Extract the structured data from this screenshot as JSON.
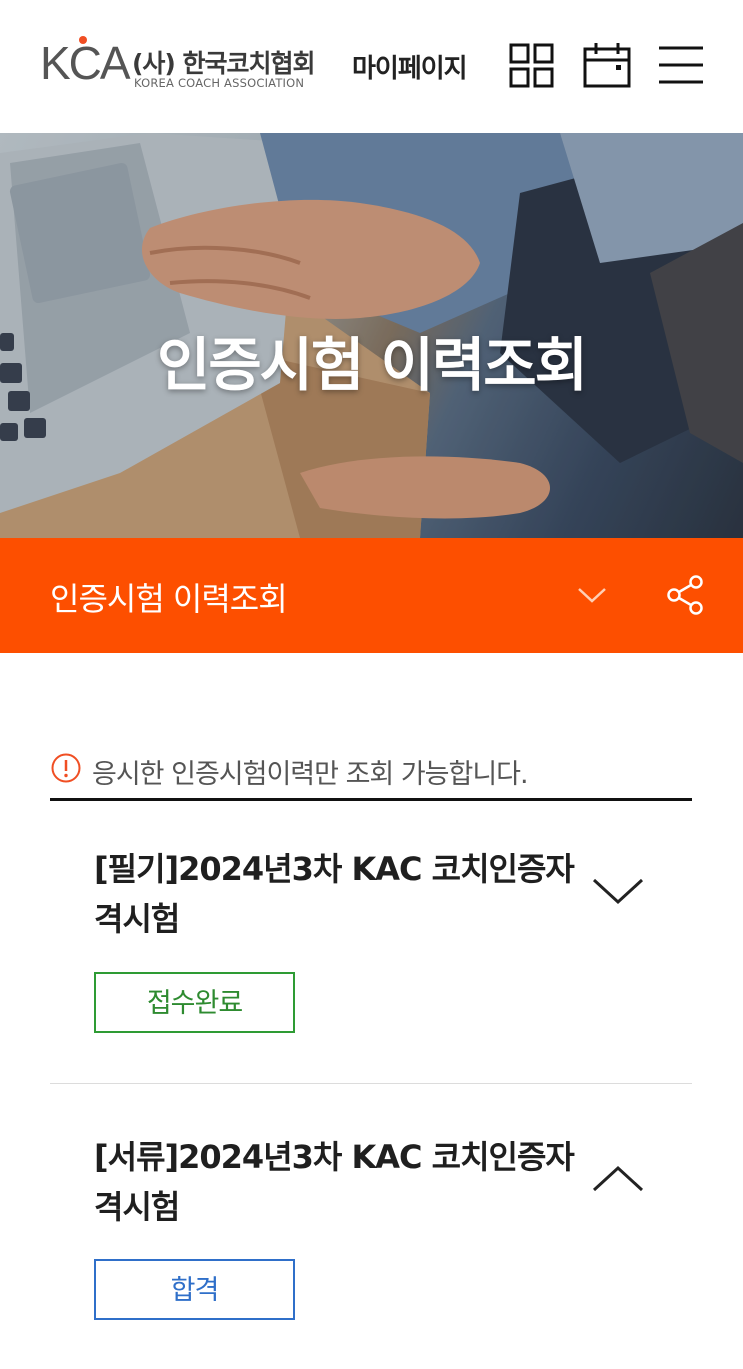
{
  "header": {
    "logo": {
      "mark": "KCA",
      "name_ko": "(사) 한국코치협회",
      "name_en": "KOREA COACH ASSOCIATION"
    },
    "mypage_label": "마이페이지",
    "icons": [
      "grid-icon",
      "calendar-icon",
      "hamburger-menu-icon"
    ]
  },
  "hero": {
    "title": "인증시험 이력조회"
  },
  "subnav": {
    "title": "인증시험 이력조회",
    "icons": [
      "chevron-down-icon",
      "share-icon"
    ]
  },
  "notice": {
    "text": "응시한 인증시험이력만 조회 가능합니다.",
    "icon": "alert-circle-icon"
  },
  "exams": [
    {
      "title": "[필기]2024년3차 KAC 코치인증자격시험",
      "status": "접수완료",
      "expanded": false,
      "status_color": "#2e8b30"
    },
    {
      "title": "[서류]2024년3차 KAC 코치인증자격시험",
      "status": "합격",
      "expanded": true,
      "status_color": "#2f6fc9"
    }
  ],
  "colors": {
    "accent": "#fd4f00",
    "logo_dot": "#f04e23"
  }
}
